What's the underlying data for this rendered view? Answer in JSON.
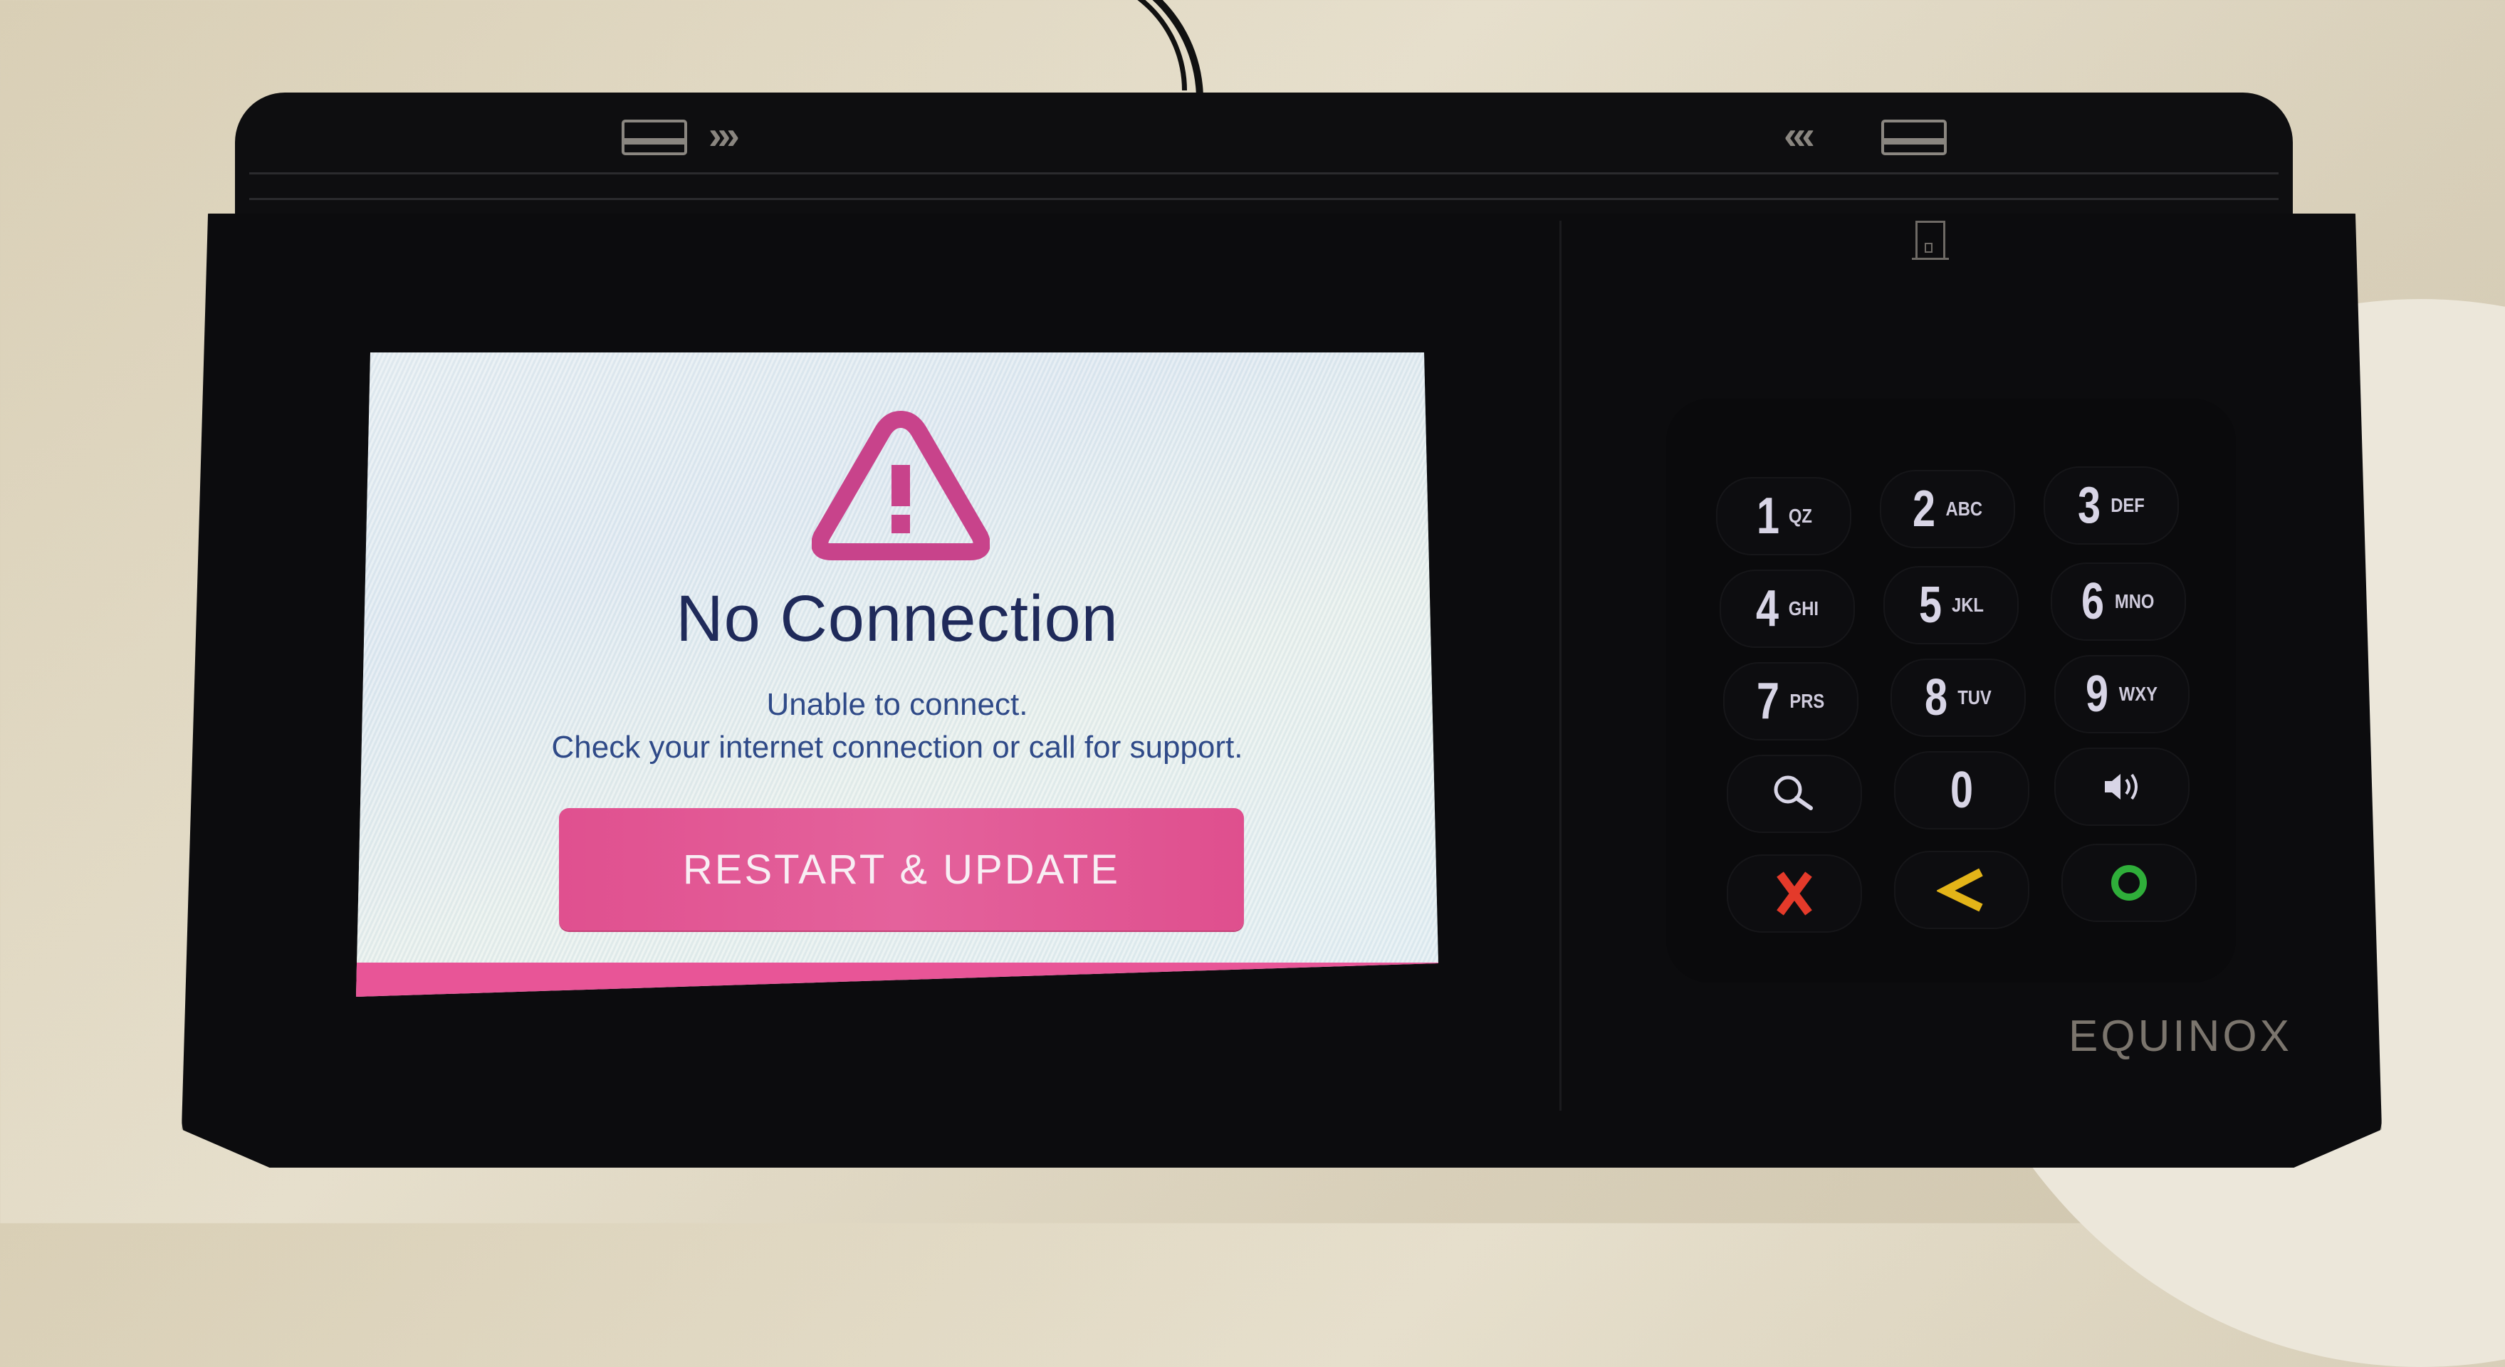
{
  "device": {
    "brand": "EQUINOX",
    "swipe_left_chevrons": "›››",
    "swipe_right_chevrons": "‹‹‹",
    "icons": [
      "card-swipe-icon",
      "chevrons-right-icon",
      "chevrons-left-icon",
      "chip-card-icon"
    ]
  },
  "screen": {
    "icon": "warning-icon",
    "title": "No Connection",
    "message_line1": "Unable to connect.",
    "message_line2": "Check your internet connection or call for support.",
    "button_label": "RESTART & UPDATE",
    "accent_color": "#e0508f",
    "title_color": "#1f2a5a",
    "text_color": "#2f4a88"
  },
  "keypad": {
    "keys": [
      {
        "num": "1",
        "letters": "QZ"
      },
      {
        "num": "2",
        "letters": "ABC"
      },
      {
        "num": "3",
        "letters": "DEF"
      },
      {
        "num": "4",
        "letters": "GHI"
      },
      {
        "num": "5",
        "letters": "JKL"
      },
      {
        "num": "6",
        "letters": "MNO"
      },
      {
        "num": "7",
        "letters": "PRS"
      },
      {
        "num": "8",
        "letters": "TUV"
      },
      {
        "num": "9",
        "letters": "WXY"
      },
      {
        "num": "0",
        "letters": ""
      }
    ],
    "function_keys": [
      {
        "name": "search",
        "icon": "search-icon"
      },
      {
        "name": "volume",
        "icon": "volume-icon"
      },
      {
        "name": "cancel",
        "icon": "cancel-x-icon",
        "color": "#e43a2a"
      },
      {
        "name": "clear",
        "icon": "backspace-chevron-icon",
        "color": "#e3b418"
      },
      {
        "name": "enter",
        "icon": "enter-o-icon",
        "color": "#2fae3a"
      }
    ]
  }
}
